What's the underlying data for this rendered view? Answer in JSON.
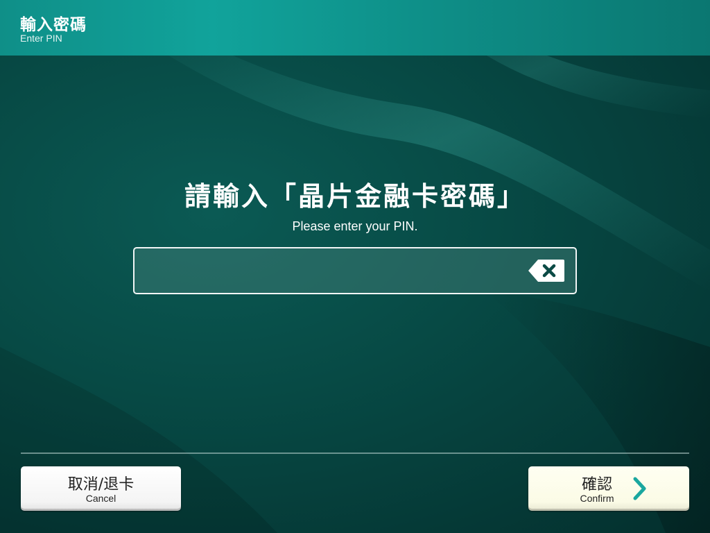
{
  "header": {
    "title": "輸入密碼",
    "subtitle": "Enter PIN"
  },
  "prompt": {
    "title": "請輸入「晶片金融卡密碼」",
    "subtitle": "Please enter your PIN."
  },
  "pin_input": {
    "value": ""
  },
  "icons": {
    "backspace": "backspace-icon",
    "confirm_arrow": "chevron-right-icon"
  },
  "buttons": {
    "cancel": {
      "label": "取消/退卡",
      "sublabel": "Cancel"
    },
    "confirm": {
      "label": "確認",
      "sublabel": "Confirm"
    }
  },
  "colors": {
    "header": "#11a39b",
    "background": "#074a45",
    "accent": "#1aa79f",
    "confirm_button": "#fbfbe6",
    "cancel_button": "#f4f4f4"
  }
}
